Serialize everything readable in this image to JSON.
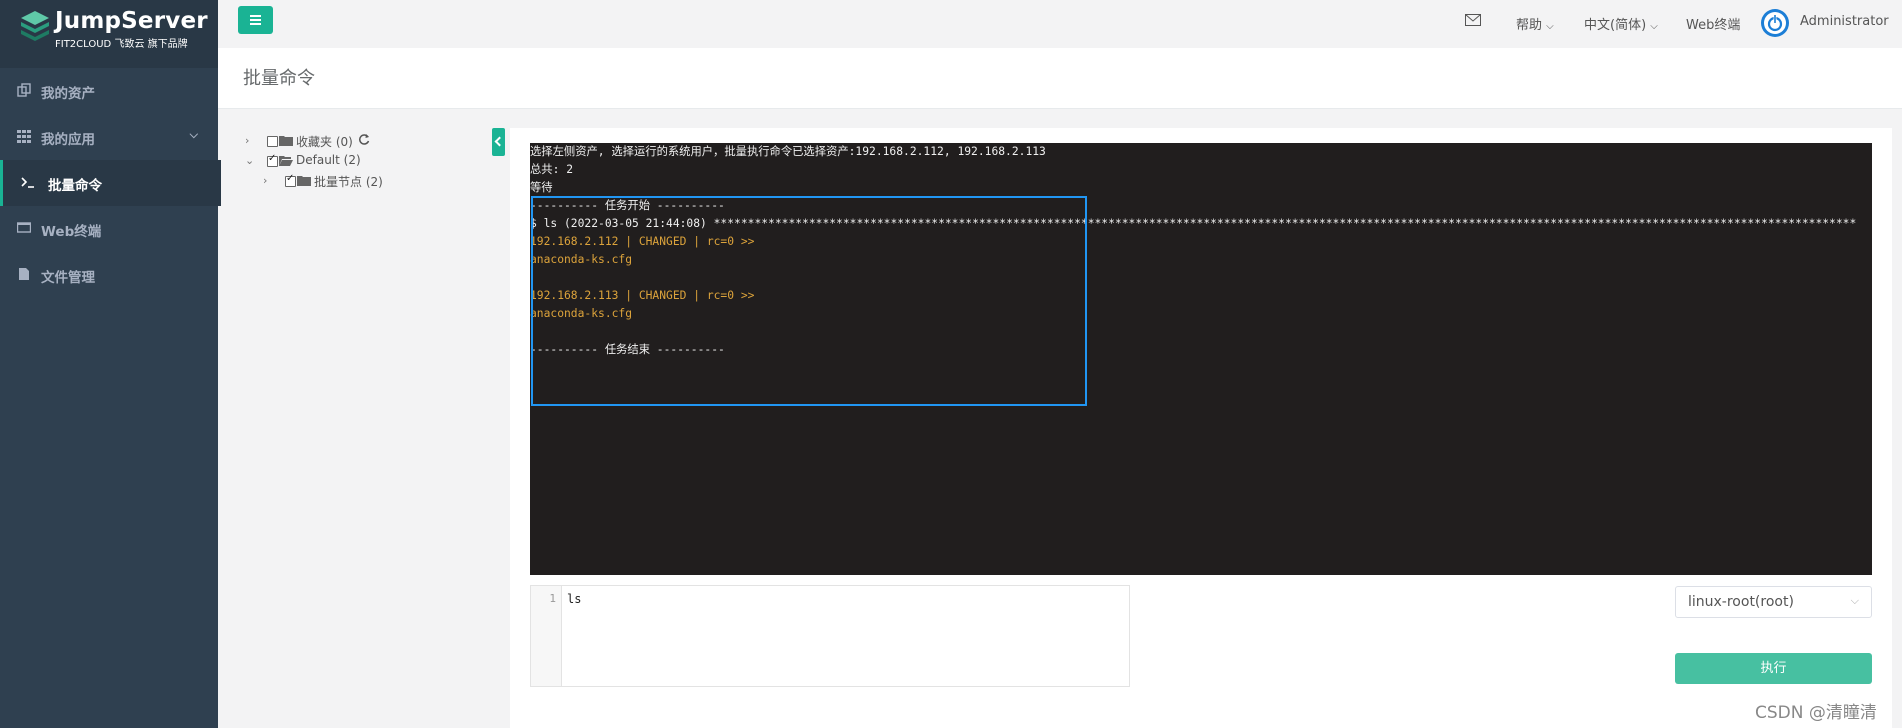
{
  "app": {
    "brand": "JumpServer",
    "brand_sub": "FIT2CLOUD 飞致云 旗下品牌",
    "accent_color": "#1ab394",
    "sidebar_color": "#2f4050"
  },
  "sidebar": {
    "items": [
      {
        "label": "我的资产",
        "icon": "assets-icon"
      },
      {
        "label": "我的应用",
        "icon": "apps-grid-icon",
        "has_submenu": true
      },
      {
        "label": "批量命令",
        "icon": "terminal-prompt-icon",
        "active": true
      },
      {
        "label": "Web终端",
        "icon": "monitor-icon"
      },
      {
        "label": "文件管理",
        "icon": "file-icon"
      }
    ]
  },
  "topbar": {
    "help_label": "帮助",
    "language_label": "中文(简体)",
    "web_terminal_label": "Web终端",
    "user_label": "Administrator"
  },
  "page": {
    "title": "批量命令"
  },
  "tree": {
    "favorites": "收藏夹 (0)",
    "default_node": "Default (2)",
    "batch_node": "批量节点 (2)"
  },
  "terminal": {
    "lines": [
      {
        "text": "选择左侧资产, 选择运行的系统用户，批量执行命令已选择资产:192.168.2.112, 192.168.2.113",
        "color": "white"
      },
      {
        "text": "总共: 2",
        "color": "white"
      },
      {
        "text": "等待",
        "color": "white"
      },
      {
        "text": "---------- 任务开始 ----------",
        "color": "white"
      },
      {
        "text": "$ ls (2022-03-05 21:44:08) ************************************************************************************************************************************************************************",
        "color": "white"
      },
      {
        "text": "192.168.2.112 | CHANGED | rc=0 >>",
        "color": "orange"
      },
      {
        "text": "anaconda-ks.cfg",
        "color": "orange"
      },
      {
        "text": "",
        "color": "white"
      },
      {
        "text": "192.168.2.113 | CHANGED | rc=0 >>",
        "color": "orange"
      },
      {
        "text": "anaconda-ks.cfg",
        "color": "orange"
      },
      {
        "text": "",
        "color": "white"
      },
      {
        "text": "---------- 任务结束 ----------",
        "color": "white"
      }
    ]
  },
  "editor": {
    "line_number": "1",
    "code": "ls"
  },
  "system_user_select": {
    "value": "linux-root(root)"
  },
  "run_button_label": "执行",
  "watermark": "CSDN @清瞳清"
}
